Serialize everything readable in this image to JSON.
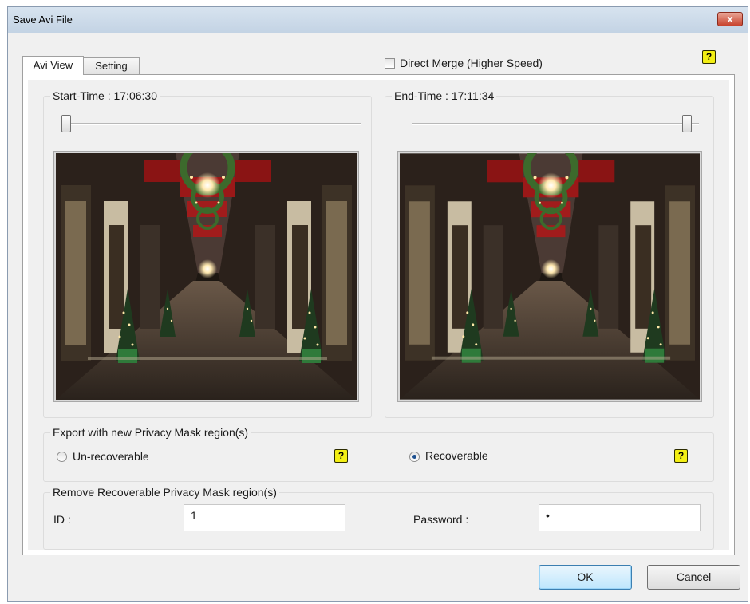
{
  "window": {
    "title": "Save Avi File",
    "close_glyph": "x"
  },
  "tabs": [
    {
      "label": "Avi View"
    },
    {
      "label": "Setting"
    }
  ],
  "direct_merge": {
    "label": "Direct Merge (Higher Speed)",
    "checked": false
  },
  "help_glyph": "?",
  "start": {
    "label": "Start-Time : 17:06:30",
    "slider_position": 0.0
  },
  "end": {
    "label": "End-Time : 17:11:34",
    "slider_position": 1.0
  },
  "privacy": {
    "group_label": "Export with new Privacy Mask region(s)",
    "unrecoverable_label": "Un-recoverable",
    "recoverable_label": "Recoverable",
    "selected": "recoverable"
  },
  "remove": {
    "group_label": "Remove Recoverable Privacy Mask region(s)",
    "id_label": "ID :",
    "id_value": "1",
    "password_label": "Password :",
    "password_value": "•"
  },
  "buttons": {
    "ok": "OK",
    "cancel": "Cancel"
  },
  "colors": {
    "help_yellow": "#f3ef14",
    "radio_selected": "#1c4f8f",
    "titlebar": "#c3d3e4"
  }
}
